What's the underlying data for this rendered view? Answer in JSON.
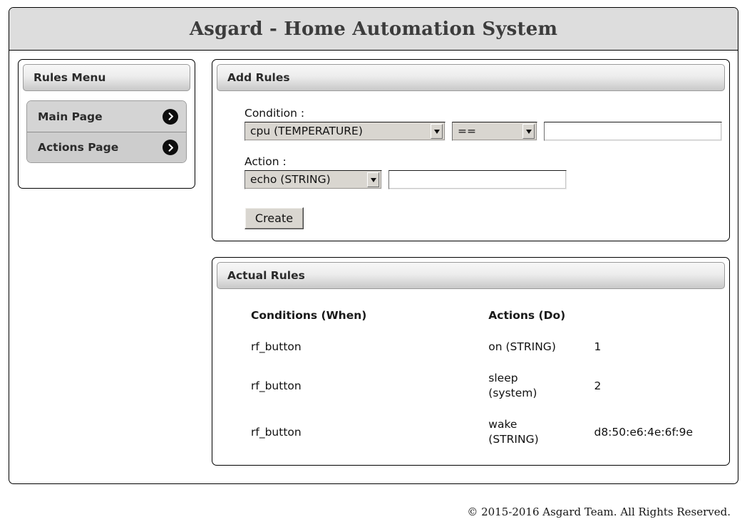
{
  "app": {
    "title": "Asgard - Home Automation System"
  },
  "sidebar": {
    "header": "Rules Menu",
    "items": [
      {
        "label": "Main Page",
        "icon": "chevron-right-circle-icon"
      },
      {
        "label": "Actions Page",
        "icon": "chevron-right-circle-icon"
      }
    ]
  },
  "add_rules": {
    "header": "Add Rules",
    "condition_label": "Condition :",
    "condition_select": "cpu (TEMPERATURE)",
    "operator_select": "==",
    "condition_value": "",
    "condition_value_placeholder": "",
    "action_label": "Action :",
    "action_select": "echo (STRING)",
    "action_value": "",
    "action_value_placeholder": "",
    "create_button": "Create"
  },
  "actual_rules": {
    "header": "Actual Rules",
    "columns": [
      "Conditions (When)",
      "Actions (Do)",
      ""
    ],
    "rows": [
      {
        "condition": "rf_button",
        "action": "on (STRING)",
        "value": "1"
      },
      {
        "condition": "rf_button",
        "action": "sleep (system)",
        "value": "2"
      },
      {
        "condition": "rf_button",
        "action": "wake (STRING)",
        "value": "d8:50:e6:4e:6f:9e"
      }
    ]
  },
  "footer": {
    "copyright": "© 2015-2016 Asgard Team. All Rights Reserved."
  },
  "colors": {
    "page_background": "#ffffff",
    "header_background": "#dddddd",
    "panel_header_gradient_top": "#f7f7f7",
    "panel_header_gradient_bottom": "#c9c9c9",
    "menu_item_background": "#d4d4d4",
    "badge_background": "#0d0d0d",
    "title_text": "#3c3c3c",
    "body_text": "#111111"
  }
}
